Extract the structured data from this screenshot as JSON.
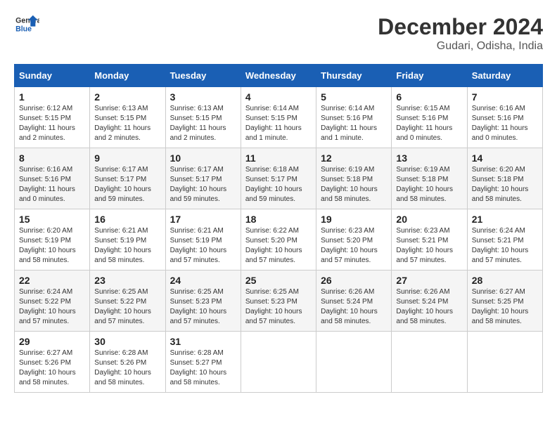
{
  "logo": {
    "line1": "General",
    "line2": "Blue"
  },
  "title": "December 2024",
  "subtitle": "Gudari, Odisha, India",
  "weekdays": [
    "Sunday",
    "Monday",
    "Tuesday",
    "Wednesday",
    "Thursday",
    "Friday",
    "Saturday"
  ],
  "weeks": [
    [
      {
        "day": "1",
        "info": "Sunrise: 6:12 AM\nSunset: 5:15 PM\nDaylight: 11 hours\nand 2 minutes."
      },
      {
        "day": "2",
        "info": "Sunrise: 6:13 AM\nSunset: 5:15 PM\nDaylight: 11 hours\nand 2 minutes."
      },
      {
        "day": "3",
        "info": "Sunrise: 6:13 AM\nSunset: 5:15 PM\nDaylight: 11 hours\nand 2 minutes."
      },
      {
        "day": "4",
        "info": "Sunrise: 6:14 AM\nSunset: 5:15 PM\nDaylight: 11 hours\nand 1 minute."
      },
      {
        "day": "5",
        "info": "Sunrise: 6:14 AM\nSunset: 5:16 PM\nDaylight: 11 hours\nand 1 minute."
      },
      {
        "day": "6",
        "info": "Sunrise: 6:15 AM\nSunset: 5:16 PM\nDaylight: 11 hours\nand 0 minutes."
      },
      {
        "day": "7",
        "info": "Sunrise: 6:16 AM\nSunset: 5:16 PM\nDaylight: 11 hours\nand 0 minutes."
      }
    ],
    [
      {
        "day": "8",
        "info": "Sunrise: 6:16 AM\nSunset: 5:16 PM\nDaylight: 11 hours\nand 0 minutes."
      },
      {
        "day": "9",
        "info": "Sunrise: 6:17 AM\nSunset: 5:17 PM\nDaylight: 10 hours\nand 59 minutes."
      },
      {
        "day": "10",
        "info": "Sunrise: 6:17 AM\nSunset: 5:17 PM\nDaylight: 10 hours\nand 59 minutes."
      },
      {
        "day": "11",
        "info": "Sunrise: 6:18 AM\nSunset: 5:17 PM\nDaylight: 10 hours\nand 59 minutes."
      },
      {
        "day": "12",
        "info": "Sunrise: 6:19 AM\nSunset: 5:18 PM\nDaylight: 10 hours\nand 58 minutes."
      },
      {
        "day": "13",
        "info": "Sunrise: 6:19 AM\nSunset: 5:18 PM\nDaylight: 10 hours\nand 58 minutes."
      },
      {
        "day": "14",
        "info": "Sunrise: 6:20 AM\nSunset: 5:18 PM\nDaylight: 10 hours\nand 58 minutes."
      }
    ],
    [
      {
        "day": "15",
        "info": "Sunrise: 6:20 AM\nSunset: 5:19 PM\nDaylight: 10 hours\nand 58 minutes."
      },
      {
        "day": "16",
        "info": "Sunrise: 6:21 AM\nSunset: 5:19 PM\nDaylight: 10 hours\nand 58 minutes."
      },
      {
        "day": "17",
        "info": "Sunrise: 6:21 AM\nSunset: 5:19 PM\nDaylight: 10 hours\nand 57 minutes."
      },
      {
        "day": "18",
        "info": "Sunrise: 6:22 AM\nSunset: 5:20 PM\nDaylight: 10 hours\nand 57 minutes."
      },
      {
        "day": "19",
        "info": "Sunrise: 6:23 AM\nSunset: 5:20 PM\nDaylight: 10 hours\nand 57 minutes."
      },
      {
        "day": "20",
        "info": "Sunrise: 6:23 AM\nSunset: 5:21 PM\nDaylight: 10 hours\nand 57 minutes."
      },
      {
        "day": "21",
        "info": "Sunrise: 6:24 AM\nSunset: 5:21 PM\nDaylight: 10 hours\nand 57 minutes."
      }
    ],
    [
      {
        "day": "22",
        "info": "Sunrise: 6:24 AM\nSunset: 5:22 PM\nDaylight: 10 hours\nand 57 minutes."
      },
      {
        "day": "23",
        "info": "Sunrise: 6:25 AM\nSunset: 5:22 PM\nDaylight: 10 hours\nand 57 minutes."
      },
      {
        "day": "24",
        "info": "Sunrise: 6:25 AM\nSunset: 5:23 PM\nDaylight: 10 hours\nand 57 minutes."
      },
      {
        "day": "25",
        "info": "Sunrise: 6:25 AM\nSunset: 5:23 PM\nDaylight: 10 hours\nand 57 minutes."
      },
      {
        "day": "26",
        "info": "Sunrise: 6:26 AM\nSunset: 5:24 PM\nDaylight: 10 hours\nand 58 minutes."
      },
      {
        "day": "27",
        "info": "Sunrise: 6:26 AM\nSunset: 5:24 PM\nDaylight: 10 hours\nand 58 minutes."
      },
      {
        "day": "28",
        "info": "Sunrise: 6:27 AM\nSunset: 5:25 PM\nDaylight: 10 hours\nand 58 minutes."
      }
    ],
    [
      {
        "day": "29",
        "info": "Sunrise: 6:27 AM\nSunset: 5:26 PM\nDaylight: 10 hours\nand 58 minutes."
      },
      {
        "day": "30",
        "info": "Sunrise: 6:28 AM\nSunset: 5:26 PM\nDaylight: 10 hours\nand 58 minutes."
      },
      {
        "day": "31",
        "info": "Sunrise: 6:28 AM\nSunset: 5:27 PM\nDaylight: 10 hours\nand 58 minutes."
      },
      null,
      null,
      null,
      null
    ]
  ]
}
